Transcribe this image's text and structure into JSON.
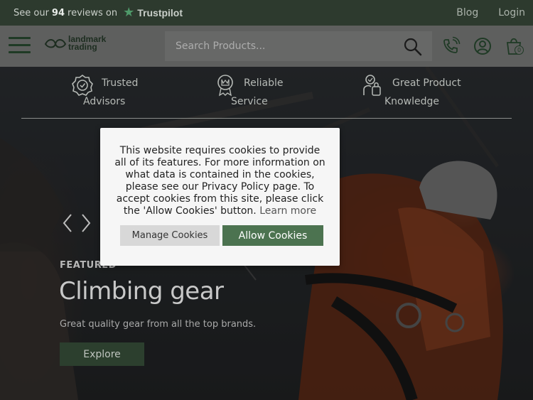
{
  "topbar": {
    "trustpilot_prefix": "See our",
    "reviews_count": "94",
    "trustpilot_suffix": "reviews on",
    "trustpilot_brand": "Trustpilot",
    "blog": "Blog",
    "login": "Login"
  },
  "header": {
    "logo_line1": "landmark",
    "logo_line2": "trading",
    "search_placeholder": "Search Products...",
    "cart_count": "0"
  },
  "features": [
    {
      "line1": "Trusted",
      "line2": "Advisors"
    },
    {
      "line1": "Reliable",
      "line2": "Service"
    },
    {
      "line1": "Great Product",
      "line2": "Knowledge"
    }
  ],
  "hero": {
    "eyebrow": "FEATURED",
    "title": "Climbing gear",
    "subtitle": "Great quality gear from all the top brands.",
    "cta": "Explore"
  },
  "cookie": {
    "message": "This website requires cookies to provide all of its features. For more information on what data is contained in the cookies, please see our Privacy Policy page. To accept cookies from this site, please click the 'Allow Cookies' button.",
    "learn_more": "Learn more",
    "manage": "Manage Cookies",
    "allow": "Allow Cookies"
  },
  "colors": {
    "topbar_bg": "#2d3a2e",
    "brand_green": "#4c7350",
    "dark_green": "#1f3a25",
    "modal_bg": "#f6f6f6"
  },
  "icons": [
    "menu-icon",
    "search-icon",
    "phone-icon",
    "account-icon",
    "cart-icon",
    "trustpilot-star-icon",
    "badge-icon",
    "ribbon-icon",
    "knowledge-icon",
    "chevron-left-icon",
    "chevron-right-icon"
  ]
}
